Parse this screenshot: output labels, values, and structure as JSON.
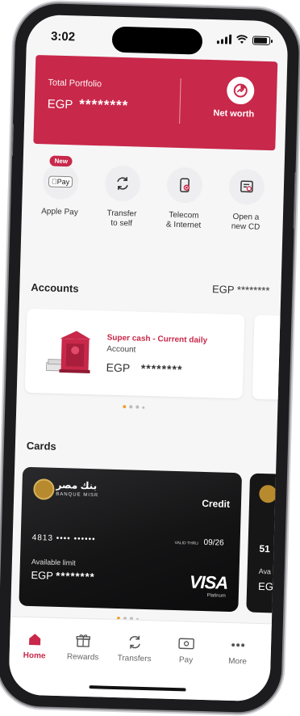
{
  "status": {
    "time": "3:02"
  },
  "portfolio": {
    "label": "Total Portfolio",
    "currency": "EGP",
    "masked_value": "********",
    "net_worth_label": "Net worth"
  },
  "quick_actions": [
    {
      "label": "Apple Pay",
      "icon": "apple-pay-icon",
      "badge": "New",
      "icon_text": "Pay"
    },
    {
      "label": "Transfer to self",
      "line1": "Transfer",
      "line2": "to self",
      "icon": "transfer-icon"
    },
    {
      "label": "Telecom & Internet",
      "line1": "Telecom",
      "line2": "& Internet",
      "icon": "phone-icon"
    },
    {
      "label": "Open a new CD",
      "line1": "Open a",
      "line2": "new CD",
      "icon": "certificate-icon"
    }
  ],
  "accounts": {
    "title": "Accounts",
    "total": "EGP ********",
    "items": [
      {
        "name": "Super cash - Current daily",
        "type": "Account",
        "currency": "EGP",
        "masked_balance": "********"
      }
    ]
  },
  "cards": {
    "title": "Cards",
    "items": [
      {
        "bank_name_ar": "بنك مصر",
        "bank_name_en": "BANQUE MISR",
        "type": "Credit",
        "number": "4813 •••• ••••••",
        "valid_label": "VALID THRU",
        "expiry": "09/26",
        "available_label": "Available limit",
        "currency": "EGP",
        "masked_limit": "********",
        "network": "VISA",
        "tier": "Platinum"
      },
      {
        "number_prefix": "51",
        "available_label": "Ava",
        "currency": "EG"
      }
    ]
  },
  "bottom_nav": [
    {
      "label": "Home",
      "icon": "home-icon",
      "active": true
    },
    {
      "label": "Rewards",
      "icon": "gift-icon"
    },
    {
      "label": "Transfers",
      "icon": "transfer-icon"
    },
    {
      "label": "Pay",
      "icon": "pay-icon"
    },
    {
      "label": "More",
      "icon": "more-icon"
    }
  ],
  "colors": {
    "brand": "#c8284a",
    "accent_dot": "#f0a030",
    "card_bg": "#141415"
  }
}
